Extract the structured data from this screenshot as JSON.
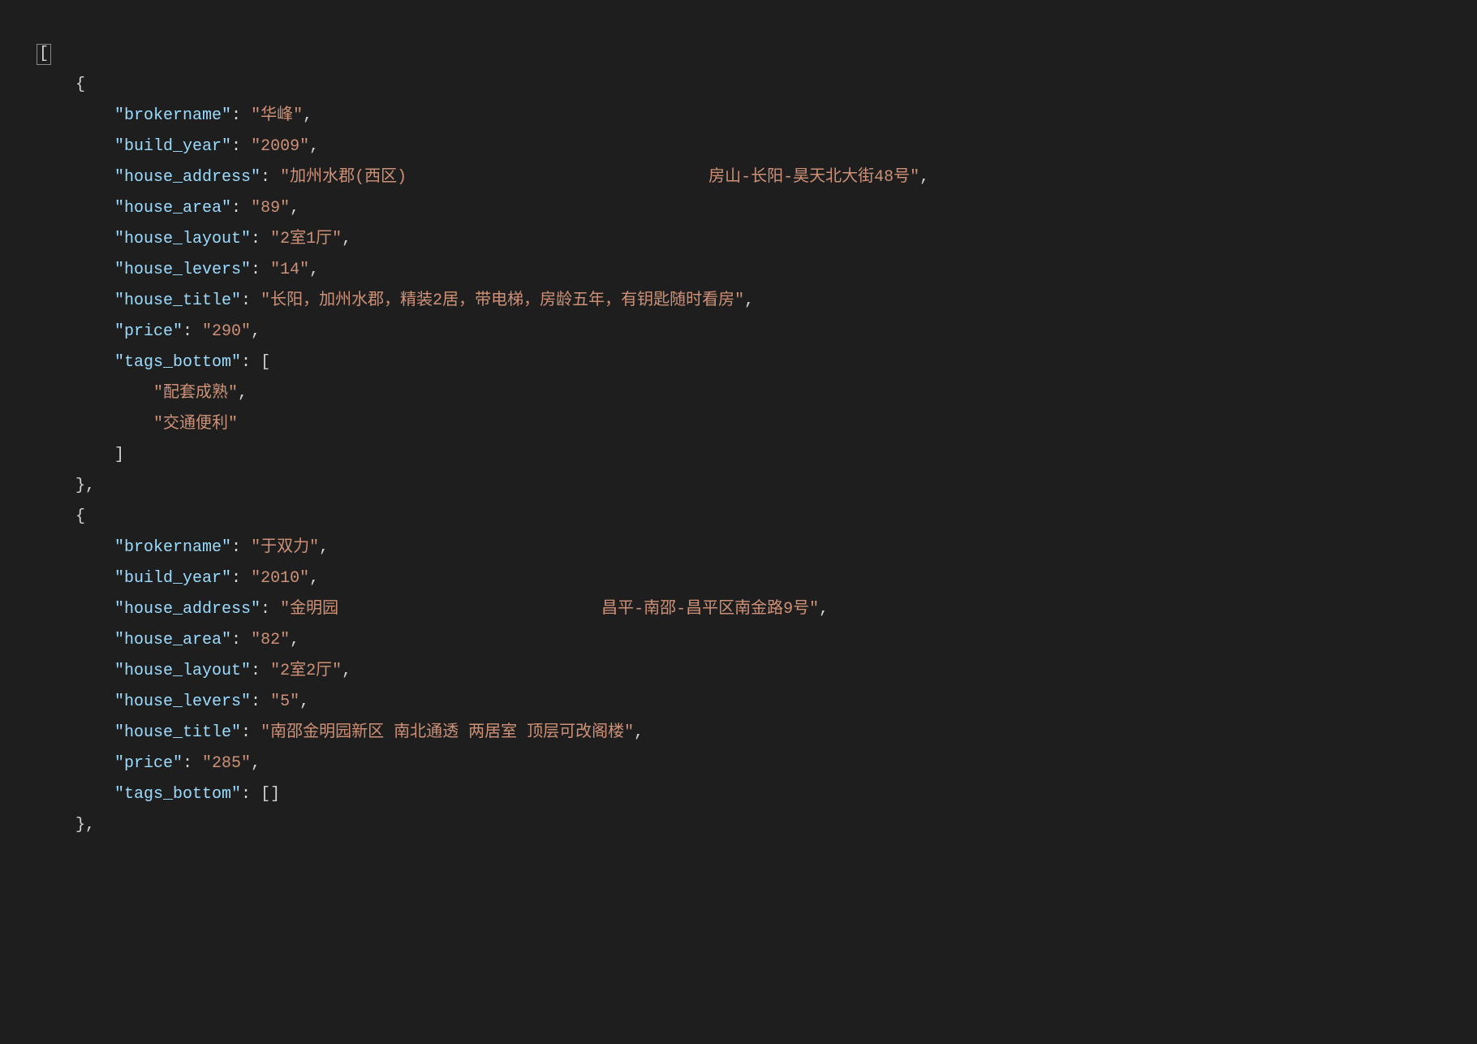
{
  "code": {
    "array_open": "[",
    "obj_open": "{",
    "obj_close_comma": "},",
    "array2_open": "[",
    "array2_close": "]",
    "array2_empty": "[]",
    "records": [
      {
        "k_brokername": "\"brokername\"",
        "v_brokername": "\"华峰\"",
        "k_build_year": "\"build_year\"",
        "v_build_year": "\"2009\"",
        "k_house_address": "\"house_address\"",
        "v_house_address": "\"加州水郡(西区)                               房山-长阳-昊天北大街48号\"",
        "k_house_area": "\"house_area\"",
        "v_house_area": "\"89\"",
        "k_house_layout": "\"house_layout\"",
        "v_house_layout": "\"2室1厅\"",
        "k_house_levers": "\"house_levers\"",
        "v_house_levers": "\"14\"",
        "k_house_title": "\"house_title\"",
        "v_house_title": "\"长阳，加州水郡，精装2居，带电梯，房龄五年，有钥匙随时看房\"",
        "k_price": "\"price\"",
        "v_price": "\"290\"",
        "k_tags_bottom": "\"tags_bottom\"",
        "tags": [
          "\"配套成熟\"",
          "\"交通便利\""
        ]
      },
      {
        "k_brokername": "\"brokername\"",
        "v_brokername": "\"于双力\"",
        "k_build_year": "\"build_year\"",
        "v_build_year": "\"2010\"",
        "k_house_address": "\"house_address\"",
        "v_house_address": "\"金明园                           昌平-南邵-昌平区南金路9号\"",
        "k_house_area": "\"house_area\"",
        "v_house_area": "\"82\"",
        "k_house_layout": "\"house_layout\"",
        "v_house_layout": "\"2室2厅\"",
        "k_house_levers": "\"house_levers\"",
        "v_house_levers": "\"5\"",
        "k_house_title": "\"house_title\"",
        "v_house_title": "\"南邵金明园新区 南北通透 两居室 顶层可改阁楼\"",
        "k_price": "\"price\"",
        "v_price": "\"285\"",
        "k_tags_bottom": "\"tags_bottom\"",
        "tags": []
      }
    ]
  }
}
